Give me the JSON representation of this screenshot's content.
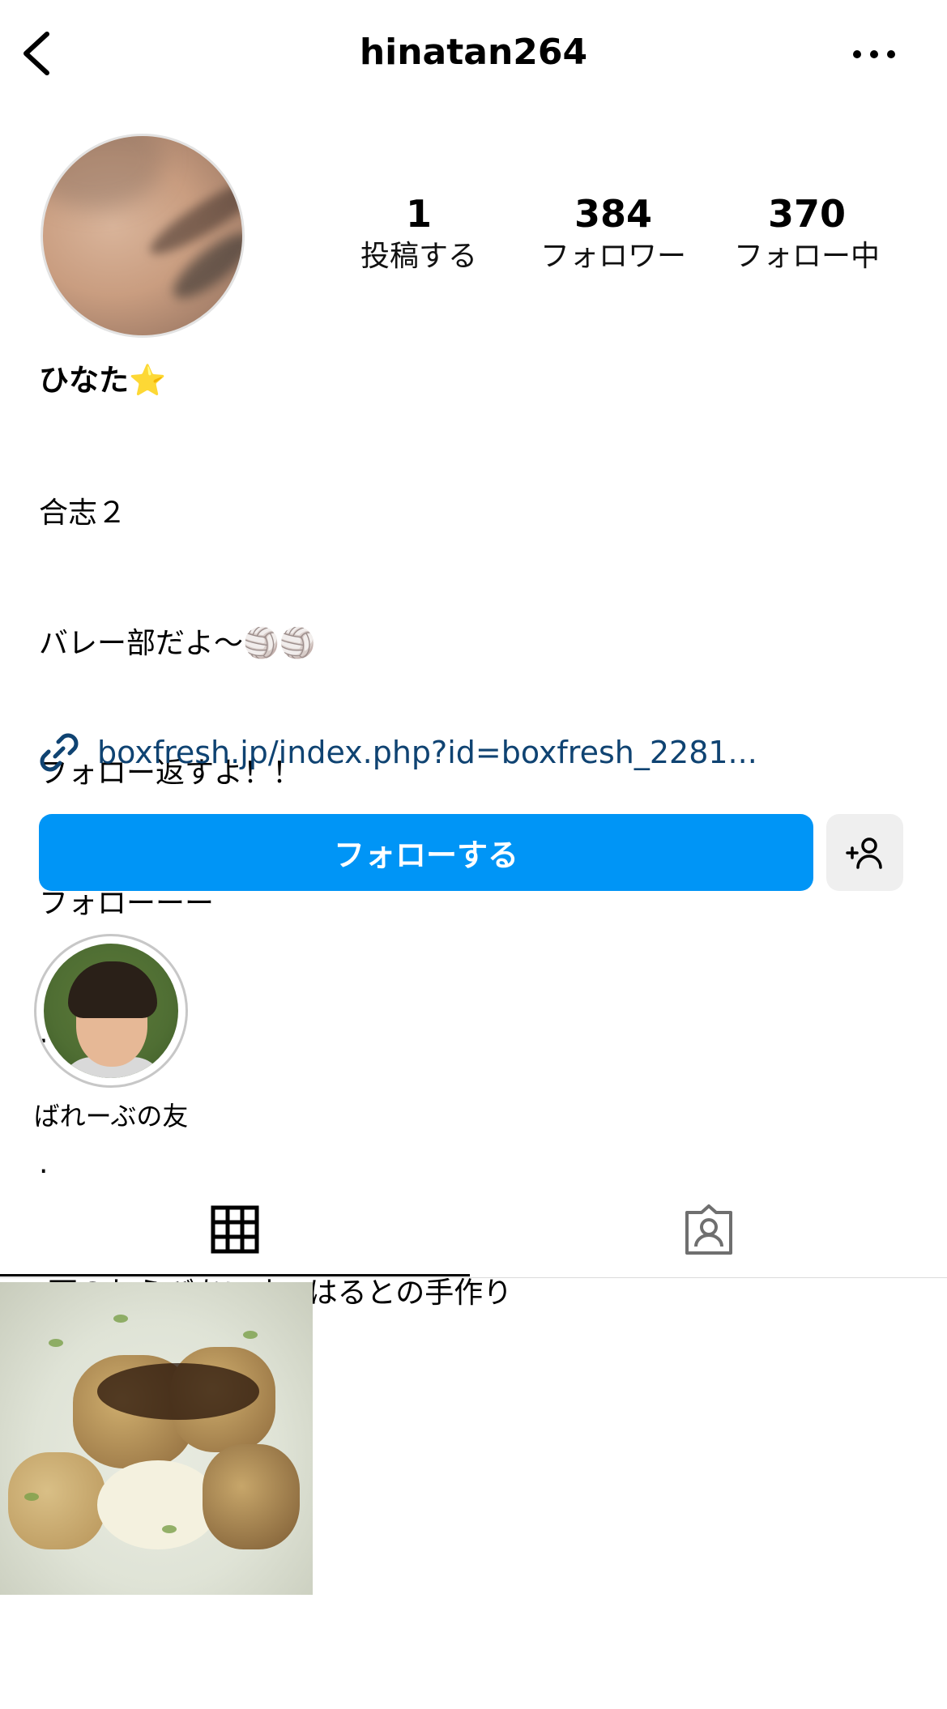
{
  "header": {
    "username": "hinatan264",
    "back_icon": "chevron-left-icon",
    "more_icon": "more-horizontal-icon"
  },
  "profile": {
    "stats": [
      {
        "value": "1",
        "label": "投稿する"
      },
      {
        "value": "384",
        "label": "フォロワー"
      },
      {
        "value": "370",
        "label": "フォロー中"
      }
    ],
    "display_name": "ひなた",
    "display_name_emoji": "⭐",
    "bio_lines": [
      "合志２",
      "バレー部だよ〜🏐🏐",
      "フォロー返すよ！！",
      "フォローーー",
      ".",
      ".",
      ".下のわらびあいす、はるとの手作り"
    ],
    "link_text": "boxfresh.jp/index.php?id=boxfresh_2281..."
  },
  "actions": {
    "follow_label": "フォローする",
    "suggest_icon": "add-person-icon"
  },
  "highlights": [
    {
      "label": "ばれーぶの友"
    }
  ],
  "tabs": {
    "grid_icon": "grid-icon",
    "tagged_icon": "tagged-person-icon",
    "active": "grid"
  },
  "colors": {
    "accent": "#0095f6",
    "link": "#0f4372",
    "secondary_button": "#efefef"
  }
}
